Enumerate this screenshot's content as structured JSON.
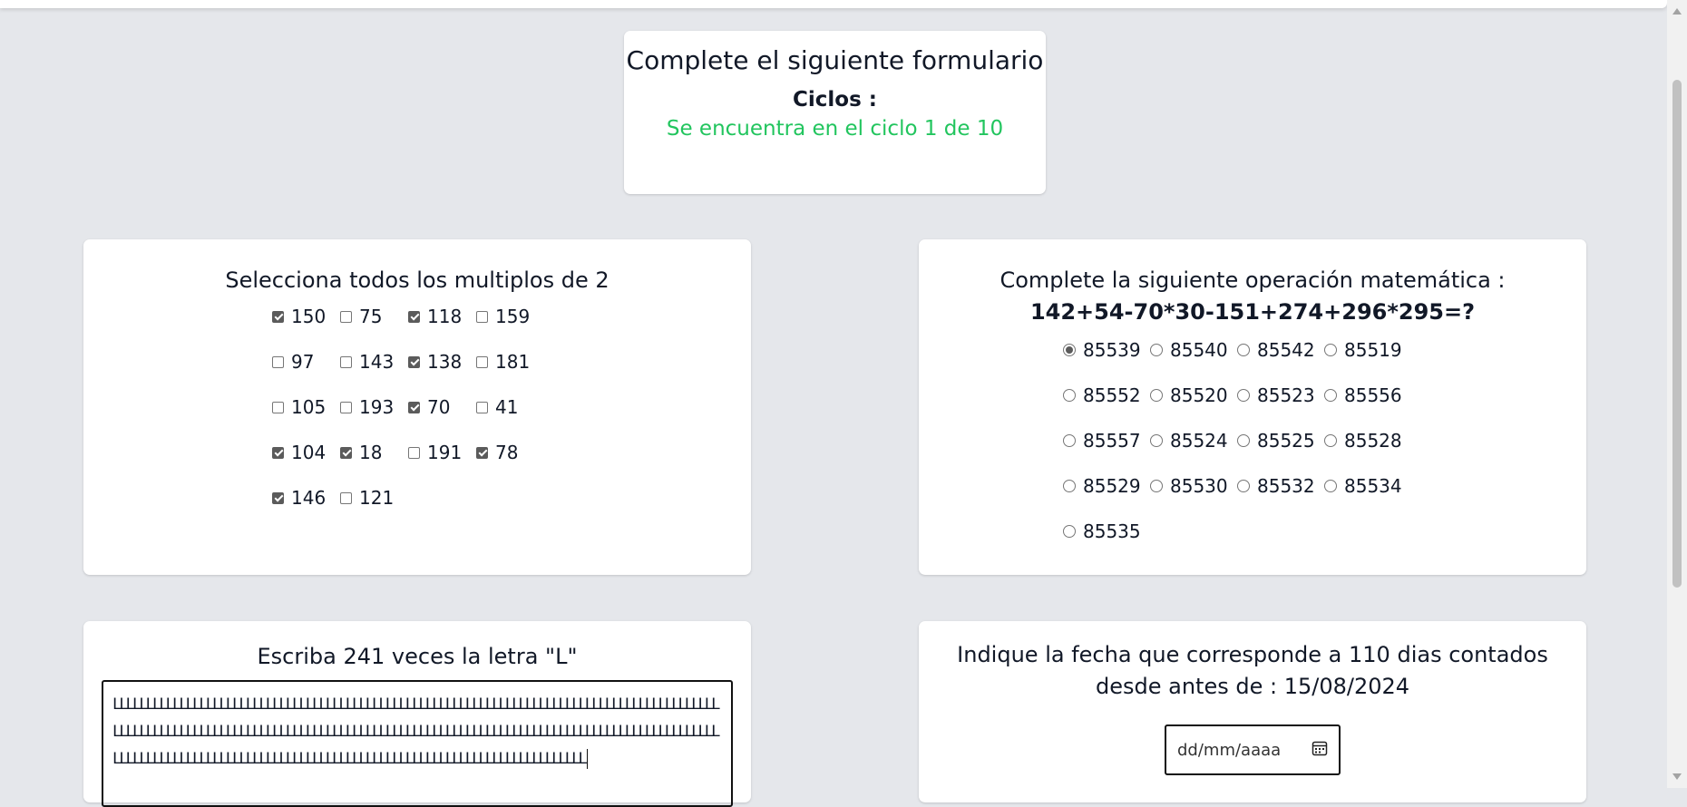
{
  "header": {
    "title": "Complete el siguiente formulario",
    "cycles_label": "Ciclos :",
    "cycles_status": "Se encuentra en el ciclo 1 de 10"
  },
  "multiples": {
    "question": "Selecciona todos los multiplos de 2",
    "options": [
      {
        "label": "150",
        "checked": true
      },
      {
        "label": "75",
        "checked": false
      },
      {
        "label": "118",
        "checked": true
      },
      {
        "label": "159",
        "checked": false
      },
      {
        "label": "97",
        "checked": false
      },
      {
        "label": "143",
        "checked": false
      },
      {
        "label": "138",
        "checked": true
      },
      {
        "label": "181",
        "checked": false
      },
      {
        "label": "105",
        "checked": false
      },
      {
        "label": "193",
        "checked": false
      },
      {
        "label": "70",
        "checked": true
      },
      {
        "label": "41",
        "checked": false
      },
      {
        "label": "104",
        "checked": true
      },
      {
        "label": "18",
        "checked": true
      },
      {
        "label": "191",
        "checked": false
      },
      {
        "label": "78",
        "checked": true
      },
      {
        "label": "146",
        "checked": true
      },
      {
        "label": "121",
        "checked": false
      }
    ]
  },
  "math": {
    "question": "Complete la siguiente operación matemática :",
    "expression": "142+54-70*30-151+274+296*295=?",
    "options": [
      {
        "label": "85539",
        "selected": true
      },
      {
        "label": "85540",
        "selected": false
      },
      {
        "label": "85542",
        "selected": false
      },
      {
        "label": "85519",
        "selected": false
      },
      {
        "label": "85552",
        "selected": false
      },
      {
        "label": "85520",
        "selected": false
      },
      {
        "label": "85523",
        "selected": false
      },
      {
        "label": "85556",
        "selected": false
      },
      {
        "label": "85557",
        "selected": false
      },
      {
        "label": "85524",
        "selected": false
      },
      {
        "label": "85525",
        "selected": false
      },
      {
        "label": "85528",
        "selected": false
      },
      {
        "label": "85529",
        "selected": false
      },
      {
        "label": "85530",
        "selected": false
      },
      {
        "label": "85532",
        "selected": false
      },
      {
        "label": "85534",
        "selected": false
      },
      {
        "label": "85535",
        "selected": false
      }
    ]
  },
  "letters": {
    "question": "Escriba 241 veces la letra \"L\"",
    "value": "LLLLLLLLLLLLLLLLLLLLLLLLLLLLLLLLLLLLLLLLLLLLLLLLLLLLLLLLLLLLLLLLLLLLLLLLLLLLLLLLLLLLLLLLLLLLLLLLLLLLLLLLLLLLLLLLLLLLLLLLLLLLLLLLLLLLLLLLLLLLLLLLLLLLLLLLLLLLLLLLLLLLLLLLLLLLLLLLLLLLLLLLLLLLLLLLLLLLLLLLLLLLLLLLLLLLLLLLLLLLLLLLLLLLLLLLLLLLLLLLLLLLLLLLLLLLL"
  },
  "date": {
    "question": "Indique la fecha que corresponde a 110 dias contados desde antes de : 15/08/2024",
    "placeholder": "dd/mm/aaaa",
    "icon": "calendar-icon"
  }
}
